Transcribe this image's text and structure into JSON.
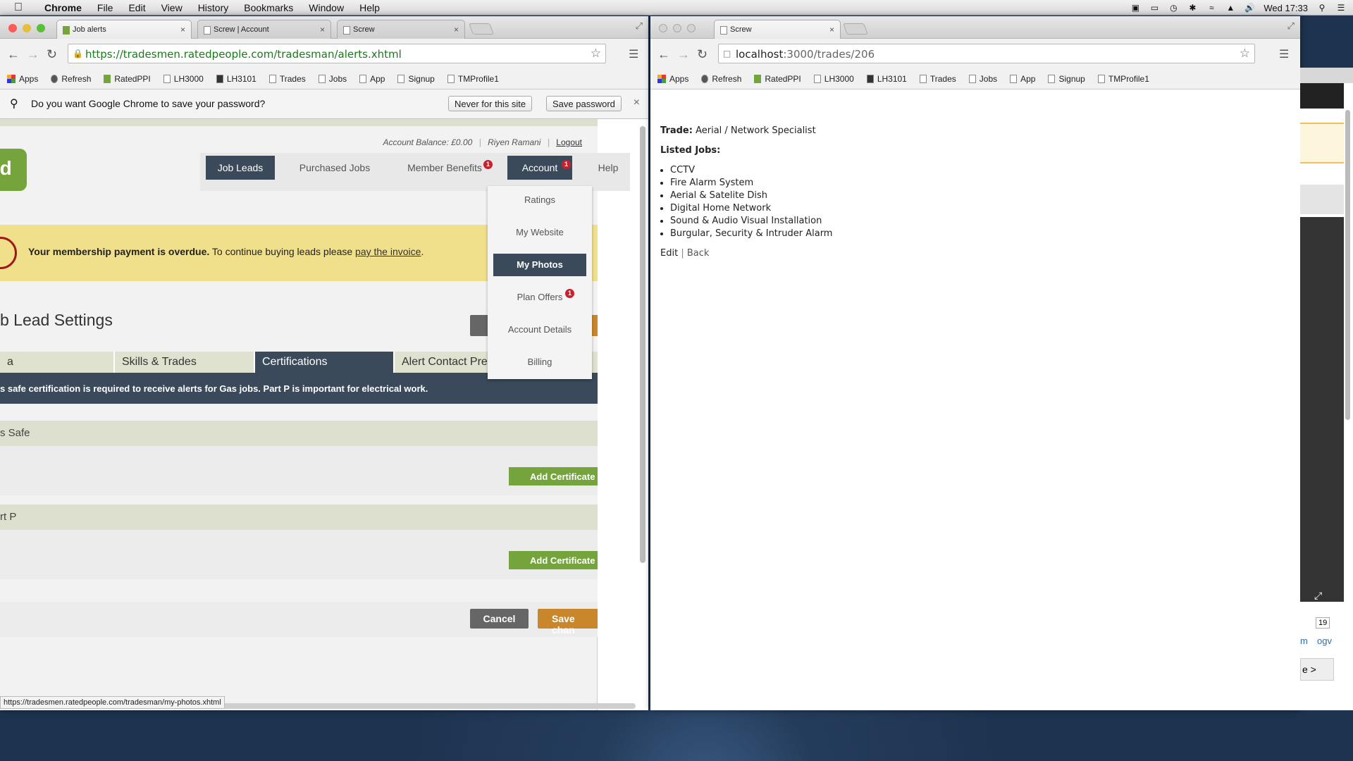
{
  "menubar": {
    "app": "Chrome",
    "items": [
      "File",
      "Edit",
      "View",
      "History",
      "Bookmarks",
      "Window",
      "Help"
    ],
    "clock": "Wed 17:33"
  },
  "left_window": {
    "tabs": [
      {
        "title": "Job alerts"
      },
      {
        "title": "Screw | Account"
      },
      {
        "title": "Screw"
      }
    ],
    "url": "https://tradesmen.ratedpeople.com/tradesman/alerts.xhtml",
    "bookmarks": [
      "Apps",
      "Refresh",
      "RatedPPI",
      "LH3000",
      "LH3101",
      "Trades",
      "Jobs",
      "App",
      "Signup",
      "TMProfile1"
    ],
    "password_bar": {
      "prompt": "Do you want Google Chrome to save your password?",
      "never_label": "Never for this site",
      "save_label": "Save password"
    },
    "site": {
      "account_balance": "Account Balance: £0.00",
      "user_name": "Riyen Ramani",
      "logout": "Logout",
      "logo_text": "ed",
      "nav": {
        "job_leads": "Job Leads",
        "purchased_jobs": "Purchased Jobs",
        "member_benefits": "Member Benefits",
        "account": "Account",
        "help": "Help",
        "member_benefits_badge": "1",
        "account_badge": "1"
      },
      "account_menu": {
        "ratings": "Ratings",
        "my_website": "My Website",
        "my_photos": "My Photos",
        "plan_offers": "Plan Offers",
        "plan_offers_badge": "1",
        "account_details": "Account Details",
        "billing": "Billing"
      },
      "alert": {
        "bold": "Your membership payment is overdue.",
        "text": " To continue buying leads please ",
        "link": "pay the invoice",
        "end": "."
      },
      "page_heading": "b Lead Settings",
      "tabs": [
        "a",
        "Skills & Trades",
        "Certifications",
        "Alert Contact Prefe"
      ],
      "info": "s safe certification is required to receive alerts for Gas jobs. Part P is important for electrical work.",
      "certs": [
        {
          "name": "s Safe",
          "button": "Add Certificate"
        },
        {
          "name": "rt P",
          "button": "Add Certificate"
        }
      ],
      "cancel": "Cancel",
      "save": "Save chan"
    },
    "status_url": "https://tradesmen.ratedpeople.com/tradesman/my-photos.xhtml"
  },
  "right_window": {
    "tab_title": "Screw",
    "url_host": "localhost",
    "url_rest": ":3000/trades/206",
    "bookmarks": [
      "Apps",
      "Refresh",
      "RatedPPI",
      "LH3000",
      "LH3101",
      "Trades",
      "Jobs",
      "App",
      "Signup",
      "TMProfile1"
    ],
    "trade_label": "Trade:",
    "trade_value": "Aerial / Network Specialist",
    "listed_jobs_label": "Listed Jobs:",
    "jobs": [
      "CCTV",
      "Fire Alarm System",
      "Aerial & Satelite Dish",
      "Digital Home Network",
      "Sound & Audio Visual Installation",
      "Burgular, Security & Intruder Alarm"
    ],
    "edit": "Edit",
    "separator": "|",
    "back": "Back"
  },
  "sliver": {
    "page_number": "19",
    "link_a": "m",
    "link_b": "ogv",
    "next": "e >"
  }
}
